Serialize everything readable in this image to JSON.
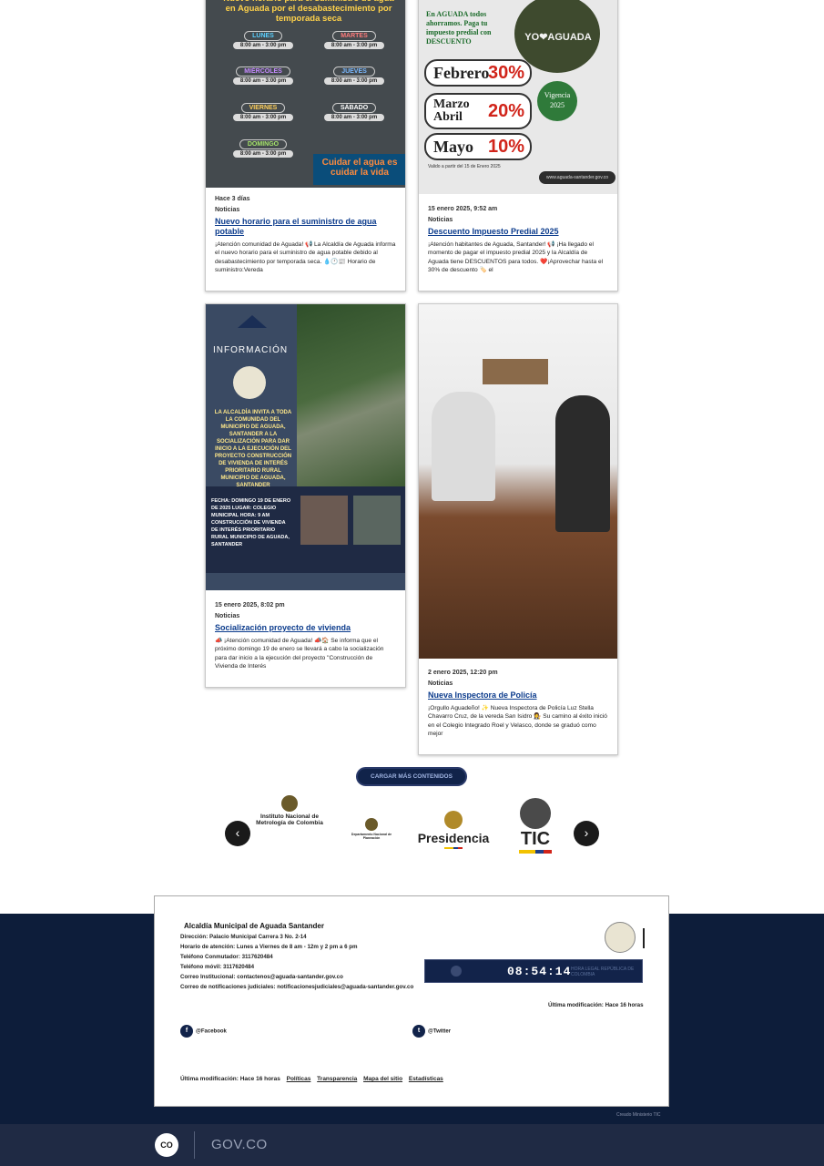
{
  "posts": [
    {
      "meta": "Hace 3 días",
      "category": "Noticias",
      "title": "Nuevo horario para el suministro de agua potable",
      "excerpt": "¡Atención comunidad de Aguada! 📢 La Alcaldía de Aguada informa el nuevo horario para el suministro de agua potable debido al desabastecimiento por temporada seca. 💧🕐📰 Horario de suministro:Vereda",
      "poster": {
        "heading": "Nuevo horario para el suministro de agua en Aguada por el desabastecimiento por temporada seca",
        "days": [
          {
            "day": "LUNES",
            "hours": "8:00 am - 3:00 pm"
          },
          {
            "day": "MARTES",
            "hours": "8:00 am - 3:00 pm"
          },
          {
            "day": "MIÉRCOLES",
            "hours": "8:00 am - 3:00 pm"
          },
          {
            "day": "JUEVES",
            "hours": "8:00 am - 3:00 pm"
          },
          {
            "day": "VIERNES",
            "hours": "8:00 am - 3:00 pm"
          },
          {
            "day": "SÁBADO",
            "hours": "8:00 am - 3:00 pm"
          },
          {
            "day": "DOMINGO",
            "hours": "8:00 am - 3:00 pm"
          }
        ],
        "slogan": "Cuidar el agua es cuidar la vida"
      }
    },
    {
      "meta": "15 enero 2025, 9:52 am",
      "category": "Noticias",
      "title": "Descuento Impuesto Predial 2025",
      "excerpt": "¡Atención habitantes de Aguada, Santander! 📢 ¡Ha llegado el momento de pagar el impuesto predial 2025 y la Alcaldía de Aguada tiene DESCUENTOS para todos. ❤️¡Aprovechar hasta el 30% de descuento 🏷️ el",
      "poster": {
        "intro": "En AGUADA todos ahorramos. Paga tu impuesto predial con DESCUENTO",
        "sign": "YO❤AGUADA",
        "discounts": [
          {
            "month": "Febrero",
            "pct": "30%"
          },
          {
            "month": "Marzo Abril",
            "pct": "20%"
          },
          {
            "month": "Mayo",
            "pct": "10%"
          }
        ],
        "vigencia": "Vigencia 2025",
        "footnote": "Valido a partir del 15 de Enero 2025",
        "site": "www.aguada-santander.gov.co"
      }
    },
    {
      "meta": "15 enero 2025, 8:02 pm",
      "category": "Noticias",
      "title": "Socialización proyecto de vivienda",
      "excerpt": "📣 ¡Atención comunidad de Aguada! 📣🏠 Se informa que el próximo domingo 19 de enero se llevará a cabo la socialización para dar inicio a la ejecución del proyecto \"Construcción de Vivienda de Interés",
      "poster": {
        "title": "INFORMACIÓN",
        "text": "LA ALCALDÍA INVITA A TODA LA COMUNIDAD DEL MUNICIPIO DE AGUADA, SANTANDER A LA SOCIALIZACIÓN PARA DAR INICIO A LA EJECUCIÓN DEL PROYECTO CONSTRUCCIÓN DE VIVIENDA DE INTERÉS PRIORITARIO RURAL MUNICIPIO DE AGUADA, SANTANDER",
        "details": "FECHA: DOMINGO 19 DE ENERO DE 2025 LUGAR: COLEGIO MUNICIPAL HORA: 9 AM CONSTRUCCIÓN DE VIVIENDA DE INTERÉS PRIORITARIO RURAL MUNICIPIO DE AGUADA, SANTANDER"
      }
    },
    {
      "meta": "2 enero 2025, 12:20 pm",
      "category": "Noticias",
      "title": "Nueva Inspectora de Policía",
      "excerpt": "¡Orgullo Aguadeño! ✨ Nueva Inspectora de Policía Luz Stella Chavarro Cruz, de la vereda San Isidro 👩‍⚖️ Su camino al éxito inició en el Colegio Integrado Roel y Velasco, donde se graduó como mejor"
    }
  ],
  "load_more": "CARGAR MÁS CONTENIDOS",
  "partners": [
    {
      "name": "Instituto Nacional de Metrología de Colombia"
    },
    {
      "name": "Departamento Nacional de Planeación"
    },
    {
      "name": "Presidencia"
    },
    {
      "name": "TIC"
    }
  ],
  "footer": {
    "entity": "Alcaldía Municipal de Aguada Santander",
    "address": "Dirección: Palacio Municipal Carrera 3 No. 2-14",
    "hours": "Horario de atención: Lunes a Viernes de 8 am - 12m y 2 pm a 6 pm",
    "phone": "Teléfono Conmutador: 3117620484",
    "mobile": "Teléfono móvil: 3117620484",
    "email": "Correo Institucional: contactenos@aguada-santander.gov.co",
    "legal_email": "Correo de notificaciones judiciales: notificacionesjudiciales@aguada-santander.gov.co",
    "clock_time": "08:54:14",
    "clock_label": "HORA LEGAL REPÚBLICA DE COLOMBIA",
    "last_modified_right": "Última modificación: Hace 16 horas",
    "facebook": "@Facebook",
    "twitter": "@Twitter",
    "last_modified_bottom": "Última modificación: Hace 16 horas",
    "links": [
      "Políticas",
      "Transparencia",
      "Mapa del sitio",
      "Estadísticas"
    ]
  },
  "credit": "Creado Ministerio TIC",
  "gov": {
    "badge": "CO",
    "brand": "GOV.CO"
  },
  "colors": {
    "footer_bg": "#0d1d3a",
    "gov_bg": "#1f2a44",
    "link_title": "#0b3b8c"
  }
}
